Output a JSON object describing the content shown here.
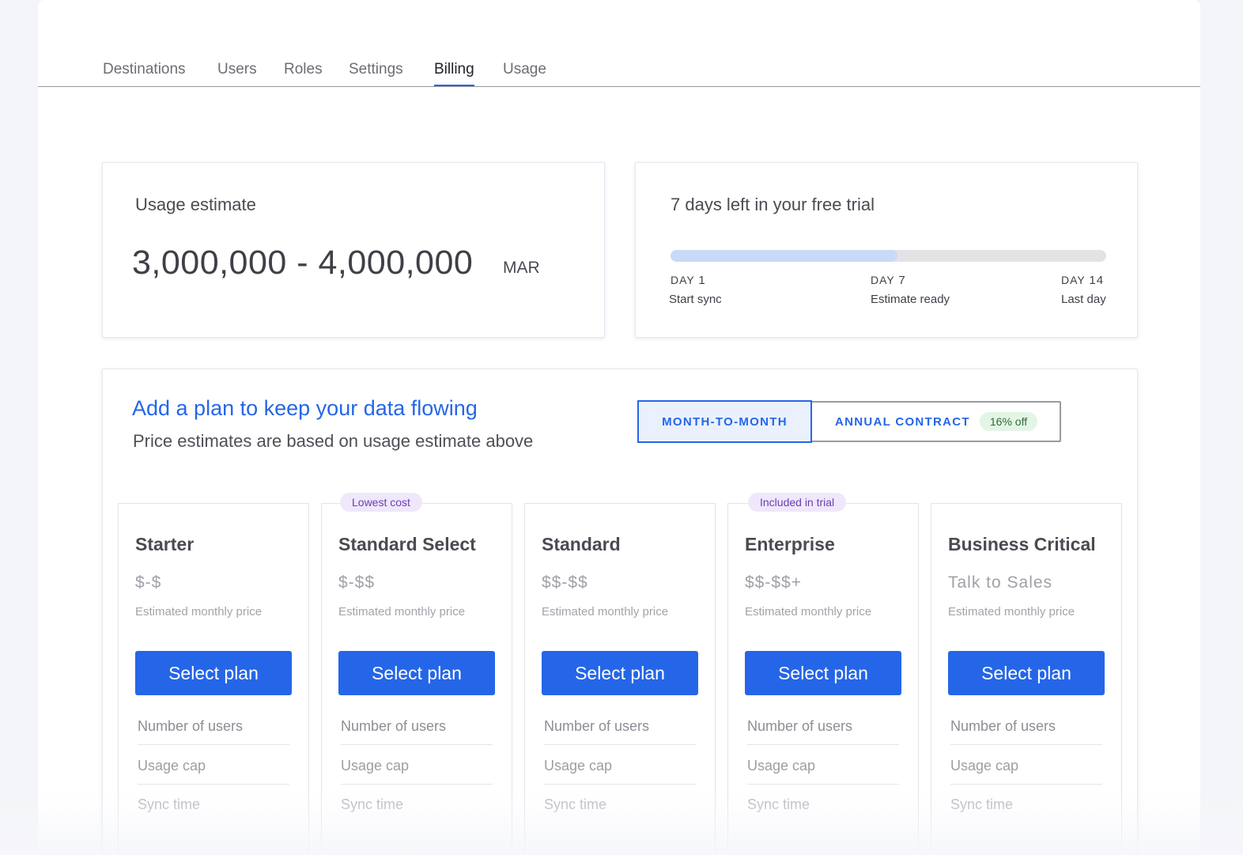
{
  "tabs": [
    {
      "label": "Destinations"
    },
    {
      "label": "Users"
    },
    {
      "label": "Roles"
    },
    {
      "label": "Settings"
    },
    {
      "label": "Billing",
      "active": true
    },
    {
      "label": "Usage"
    }
  ],
  "usage": {
    "label": "Usage estimate",
    "value": "3,000,000 - 4,000,000",
    "unit": "MAR"
  },
  "trial": {
    "title": "7 days left in your free trial",
    "progress_fraction": 0.52,
    "milestones": [
      {
        "day_label": "DAY",
        "day_num": "1",
        "caption": "Start sync"
      },
      {
        "day_label": "DAY",
        "day_num": "7",
        "caption": "Estimate ready"
      },
      {
        "day_label": "DAY",
        "day_num": "14",
        "caption": "Last day"
      }
    ]
  },
  "plans": {
    "heading": "Add a plan to keep your data flowing",
    "subheading": "Price estimates are based on usage estimate above",
    "toggle": {
      "monthly": "MONTH-TO-MONTH",
      "annual": "ANNUAL CONTRACT",
      "annual_discount": "16% off",
      "selected": "monthly"
    },
    "tiers": [
      {
        "name": "Starter",
        "badge": "",
        "price": "$-$",
        "price_note": "Estimated monthly price",
        "button": "Select plan",
        "features": [
          "Number of users",
          "Usage cap",
          "Sync time"
        ]
      },
      {
        "name": "Standard Select",
        "badge": "Lowest cost",
        "price": "$-$$",
        "price_note": "Estimated monthly price",
        "button": "Select plan",
        "features": [
          "Number of users",
          "Usage cap",
          "Sync time"
        ]
      },
      {
        "name": "Standard",
        "badge": "",
        "price": "$$-$$",
        "price_note": "Estimated monthly price",
        "button": "Select plan",
        "features": [
          "Number of users",
          "Usage cap",
          "Sync time"
        ]
      },
      {
        "name": "Enterprise",
        "badge": "Included in trial",
        "price": "$$-$$+",
        "price_note": "Estimated monthly price",
        "button": "Select plan",
        "features": [
          "Number of users",
          "Usage cap",
          "Sync time"
        ]
      },
      {
        "name": "Business Critical",
        "badge": "",
        "price": "Talk to Sales",
        "price_note": "Estimated monthly price",
        "button": "Select plan",
        "features": [
          "Number of users",
          "Usage cap",
          "Sync time"
        ]
      }
    ]
  },
  "colors": {
    "accent": "#2566e8",
    "progress_fill": "#c9daf8",
    "badge_purple": "#6a3fb3",
    "discount_green": "#2f6b36"
  }
}
